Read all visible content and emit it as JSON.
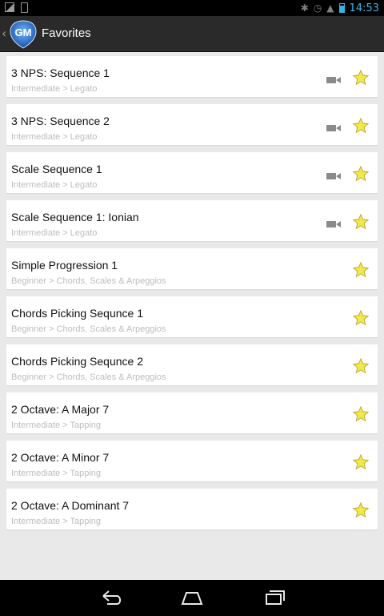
{
  "status": {
    "time": "14:53"
  },
  "actionbar": {
    "title": "Favorites"
  },
  "items": [
    {
      "title": "3 NPS: Sequence 1",
      "subtitle": "Intermediate > Legato",
      "has_video": true
    },
    {
      "title": "3 NPS: Sequence 2",
      "subtitle": "Intermediate > Legato",
      "has_video": true
    },
    {
      "title": "Scale Sequence 1",
      "subtitle": "Intermediate > Legato",
      "has_video": true
    },
    {
      "title": "Scale Sequence 1: Ionian",
      "subtitle": "Intermediate > Legato",
      "has_video": true
    },
    {
      "title": "Simple Progression 1",
      "subtitle": "Beginner > Chords, Scales & Arpeggios",
      "has_video": false
    },
    {
      "title": "Chords Picking Sequnce 1",
      "subtitle": "Beginner > Chords, Scales & Arpeggios",
      "has_video": false
    },
    {
      "title": "Chords Picking Sequnce 2",
      "subtitle": "Beginner > Chords, Scales & Arpeggios",
      "has_video": false
    },
    {
      "title": "2 Octave: A Major 7",
      "subtitle": "Intermediate > Tapping",
      "has_video": false
    },
    {
      "title": "2 Octave: A Minor 7",
      "subtitle": "Intermediate > Tapping",
      "has_video": false
    },
    {
      "title": "2 Octave: A Dominant 7",
      "subtitle": "Intermediate > Tapping",
      "has_video": false
    }
  ],
  "icons": {
    "favorite": "star-icon",
    "video": "video-camera-icon"
  },
  "colors": {
    "star_fill": "#f2e84d",
    "star_stroke": "#b9a92a",
    "accent": "#33b5e5"
  }
}
